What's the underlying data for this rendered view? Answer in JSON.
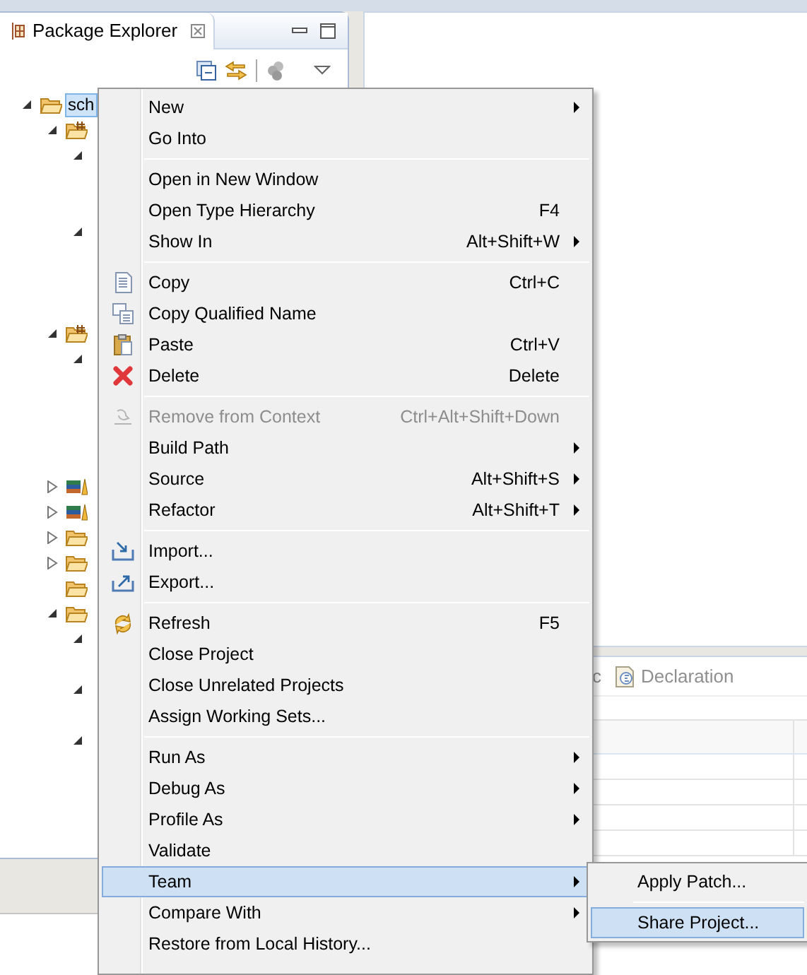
{
  "package_explorer": {
    "title": "Package Explorer",
    "tree": [
      {
        "label": "sch",
        "kind": "project",
        "expanded": true,
        "selected": true,
        "children": [
          {
            "kind": "package-folder",
            "expanded": true,
            "selected": false,
            "children": [
              {
                "expanded": true,
                "selected": false
              },
              {
                "expanded": true,
                "selected": false
              }
            ]
          },
          {
            "kind": "package-folder",
            "expanded": true,
            "selected": false,
            "children": [
              {
                "expanded": true,
                "selected": false
              }
            ]
          },
          {
            "kind": "library",
            "expanded": false,
            "selected": false
          },
          {
            "kind": "library",
            "expanded": false,
            "selected": false
          },
          {
            "kind": "folder",
            "expanded": false,
            "selected": false
          },
          {
            "kind": "folder",
            "expanded": false,
            "selected": false
          },
          {
            "kind": "folder",
            "selected": false
          },
          {
            "kind": "folder",
            "expanded": true,
            "selected": false,
            "children": [
              {
                "expanded": true,
                "selected": false
              },
              {
                "expanded": true,
                "selected": false
              },
              {
                "expanded": true,
                "selected": false
              }
            ]
          }
        ]
      }
    ]
  },
  "bottom_panel": {
    "tabs": [
      {
        "label": "c",
        "selected": false
      },
      {
        "label": "Declaration",
        "selected": false
      }
    ]
  },
  "context_menu": [
    {
      "kind": "item",
      "label": "New",
      "submenu": true,
      "disabled": false,
      "selected": false
    },
    {
      "kind": "item",
      "label": "Go Into",
      "submenu": false,
      "disabled": false,
      "selected": false
    },
    {
      "kind": "separator"
    },
    {
      "kind": "item",
      "label": "Open in New Window",
      "submenu": false,
      "disabled": false,
      "selected": false
    },
    {
      "kind": "item",
      "label": "Open Type Hierarchy",
      "shortcut": "F4",
      "submenu": false,
      "disabled": false,
      "selected": false
    },
    {
      "kind": "item",
      "label": "Show In",
      "shortcut": "Alt+Shift+W",
      "submenu": true,
      "disabled": false,
      "selected": false
    },
    {
      "kind": "separator"
    },
    {
      "kind": "item",
      "label": "Copy",
      "shortcut": "Ctrl+C",
      "submenu": false,
      "disabled": false,
      "selected": false
    },
    {
      "kind": "item",
      "label": "Copy Qualified Name",
      "submenu": false,
      "disabled": false,
      "selected": false
    },
    {
      "kind": "item",
      "label": "Paste",
      "shortcut": "Ctrl+V",
      "submenu": false,
      "disabled": false,
      "selected": false
    },
    {
      "kind": "item",
      "label": "Delete",
      "shortcut": "Delete",
      "submenu": false,
      "disabled": false,
      "selected": false
    },
    {
      "kind": "separator"
    },
    {
      "kind": "item",
      "label": "Remove from Context",
      "shortcut": "Ctrl+Alt+Shift+Down",
      "submenu": false,
      "disabled": true,
      "selected": false
    },
    {
      "kind": "item",
      "label": "Build Path",
      "submenu": true,
      "disabled": false,
      "selected": false
    },
    {
      "kind": "item",
      "label": "Source",
      "shortcut": "Alt+Shift+S",
      "submenu": true,
      "disabled": false,
      "selected": false
    },
    {
      "kind": "item",
      "label": "Refactor",
      "shortcut": "Alt+Shift+T",
      "submenu": true,
      "disabled": false,
      "selected": false
    },
    {
      "kind": "separator"
    },
    {
      "kind": "item",
      "label": "Import...",
      "submenu": false,
      "disabled": false,
      "selected": false
    },
    {
      "kind": "item",
      "label": "Export...",
      "submenu": false,
      "disabled": false,
      "selected": false
    },
    {
      "kind": "separator"
    },
    {
      "kind": "item",
      "label": "Refresh",
      "shortcut": "F5",
      "submenu": false,
      "disabled": false,
      "selected": false
    },
    {
      "kind": "item",
      "label": "Close Project",
      "submenu": false,
      "disabled": false,
      "selected": false
    },
    {
      "kind": "item",
      "label": "Close Unrelated Projects",
      "submenu": false,
      "disabled": false,
      "selected": false
    },
    {
      "kind": "item",
      "label": "Assign Working Sets...",
      "submenu": false,
      "disabled": false,
      "selected": false
    },
    {
      "kind": "separator"
    },
    {
      "kind": "item",
      "label": "Run As",
      "submenu": true,
      "disabled": false,
      "selected": false
    },
    {
      "kind": "item",
      "label": "Debug As",
      "submenu": true,
      "disabled": false,
      "selected": false
    },
    {
      "kind": "item",
      "label": "Profile As",
      "submenu": true,
      "disabled": false,
      "selected": false
    },
    {
      "kind": "item",
      "label": "Validate",
      "submenu": false,
      "disabled": false,
      "selected": false
    },
    {
      "kind": "item",
      "label": "Team",
      "submenu": true,
      "disabled": false,
      "selected": true
    },
    {
      "kind": "item",
      "label": "Compare With",
      "submenu": true,
      "disabled": false,
      "selected": false
    },
    {
      "kind": "item",
      "label": "Restore from Local History...",
      "submenu": false,
      "disabled": false,
      "selected": false
    }
  ],
  "team_submenu": [
    {
      "kind": "item",
      "label": "Apply Patch...",
      "selected": false
    },
    {
      "kind": "separator"
    },
    {
      "kind": "item",
      "label": "Share Project...",
      "selected": true
    }
  ]
}
